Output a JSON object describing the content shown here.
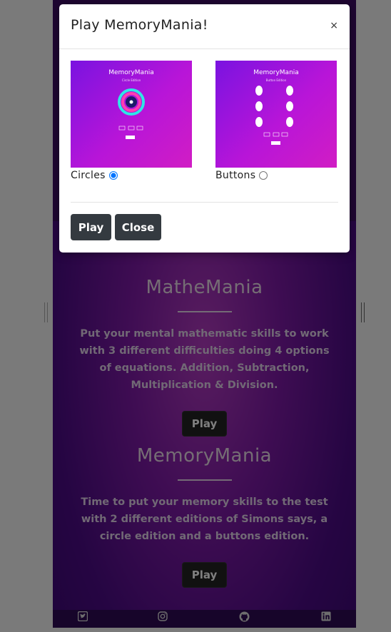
{
  "modal": {
    "title": "Play MemoryMania!",
    "close_icon": "×",
    "options": [
      {
        "label": "Circles",
        "selected": true,
        "thumb_title": "MemoryMania",
        "thumb_sub": "Circle Edition"
      },
      {
        "label": "Buttons",
        "selected": false,
        "thumb_title": "MemoryMania",
        "thumb_sub": "Button Edition"
      }
    ],
    "play_label": "Play",
    "close_label": "Close"
  },
  "sections": [
    {
      "title": "MatheMania",
      "description": "Put your mental mathematic skills to work with 3 different difficulties doing 4 options of equations. Addition, Subtraction, Multiplication & Division.",
      "play_label": "Play"
    },
    {
      "title": "MemoryMania",
      "description": "Time to put your memory skills to the test with 2 different editions of Simons says, a circle edition and a buttons edition.",
      "play_label": "Play"
    }
  ],
  "footer_icons": [
    "twitter-icon",
    "instagram-icon",
    "github-icon",
    "linkedin-icon"
  ],
  "colors": {
    "primary_bg": "#4c0b86",
    "accent": "#b23ac0",
    "button_dark": "#343a40"
  }
}
